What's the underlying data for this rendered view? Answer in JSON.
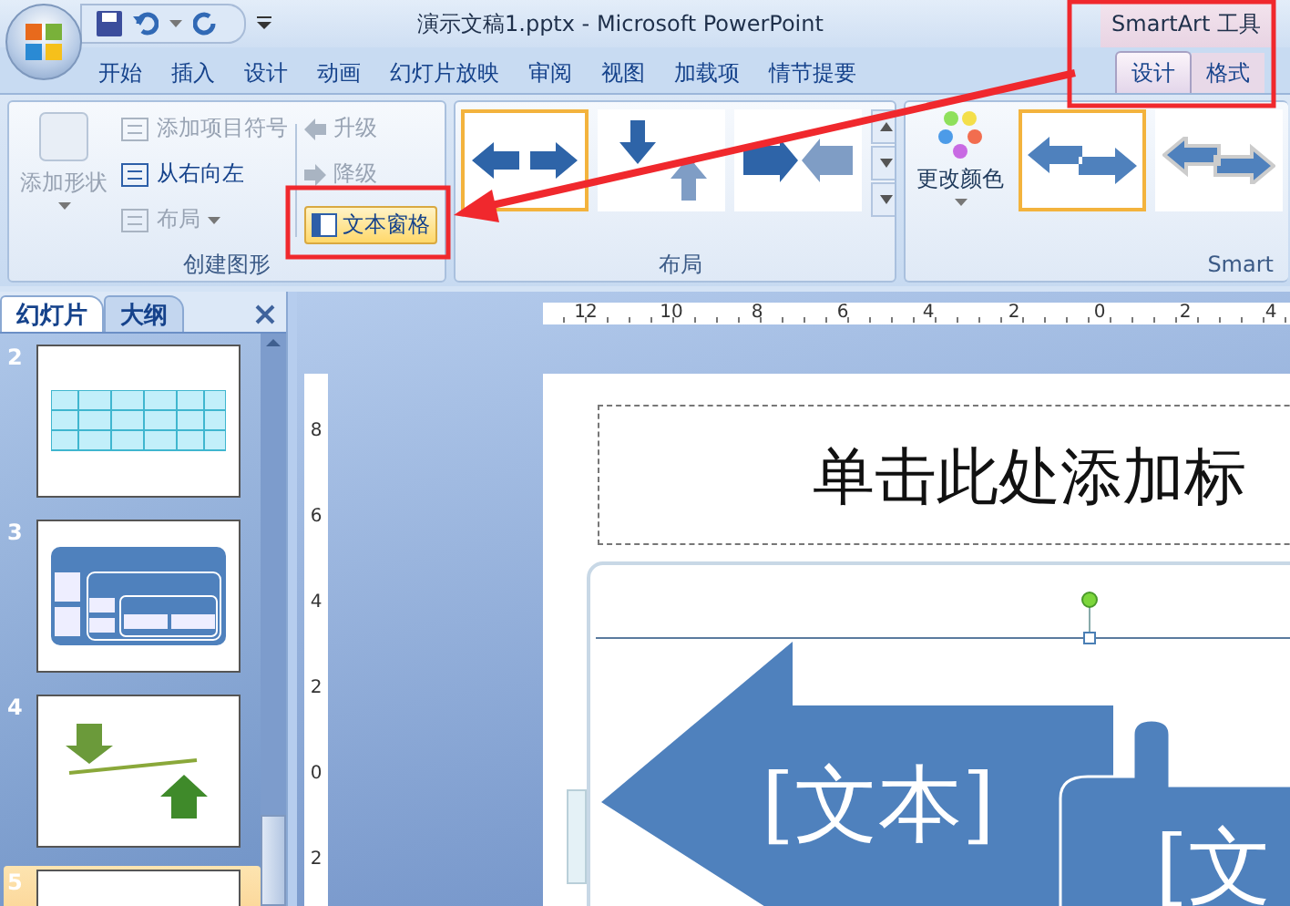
{
  "title_bar": {
    "title": "演示文稿1.pptx - Microsoft PowerPoint",
    "context_header": "SmartArt 工具"
  },
  "ribbon_tabs": [
    {
      "label": "开始",
      "selected": false,
      "context": false
    },
    {
      "label": "插入",
      "selected": false,
      "context": false
    },
    {
      "label": "设计",
      "selected": false,
      "context": false
    },
    {
      "label": "动画",
      "selected": false,
      "context": false
    },
    {
      "label": "幻灯片放映",
      "selected": false,
      "context": false
    },
    {
      "label": "审阅",
      "selected": false,
      "context": false
    },
    {
      "label": "视图",
      "selected": false,
      "context": false
    },
    {
      "label": "加载项",
      "selected": false,
      "context": false
    },
    {
      "label": "情节提要",
      "selected": false,
      "context": false
    },
    {
      "label": "设计",
      "selected": true,
      "context": true
    },
    {
      "label": "格式",
      "selected": false,
      "context": true
    }
  ],
  "create_graphic": {
    "label": "创建图形",
    "add_shape": {
      "label": "添加形状",
      "disabled": true
    },
    "items": [
      {
        "label": "添加项目符号",
        "disabled": true,
        "dropdown": false
      },
      {
        "label": "从右向左",
        "disabled": false,
        "dropdown": false
      },
      {
        "label": "布局",
        "disabled": true,
        "dropdown": true
      }
    ],
    "levels": [
      {
        "label": "升级",
        "disabled": true
      },
      {
        "label": "降级",
        "disabled": true
      }
    ],
    "text_pane": {
      "label": "文本窗格",
      "on": true
    }
  },
  "layouts": {
    "label": "布局",
    "items": [
      {
        "kind": "double",
        "selected": true
      },
      {
        "kind": "updown",
        "selected": false
      },
      {
        "kind": "facing",
        "selected": false
      }
    ]
  },
  "smartart_styles": {
    "label": "Smart",
    "change_colors": "更改颜色",
    "items": [
      {
        "kind": "flat",
        "selected": true
      },
      {
        "kind": "outlined",
        "selected": false
      }
    ]
  },
  "pane": {
    "tabs": [
      {
        "label": "幻灯片",
        "selected": true
      },
      {
        "label": "大纲",
        "selected": false
      }
    ],
    "slides": [
      {
        "number": "2",
        "kind": "table",
        "selected": false
      },
      {
        "number": "3",
        "kind": "diagram",
        "selected": false
      },
      {
        "number": "4",
        "kind": "arrows",
        "selected": false
      },
      {
        "number": "5",
        "kind": "blank",
        "selected": true
      }
    ]
  },
  "ruler": {
    "horizontal": [
      "12",
      "10",
      "8",
      "6",
      "4",
      "2",
      "0",
      "2",
      "4"
    ],
    "vertical": [
      "8",
      "6",
      "4",
      "2",
      "0",
      "2"
    ]
  },
  "slide": {
    "title_placeholder": "单击此处添加标",
    "shapes": [
      "[文本]",
      "[文"
    ]
  }
}
